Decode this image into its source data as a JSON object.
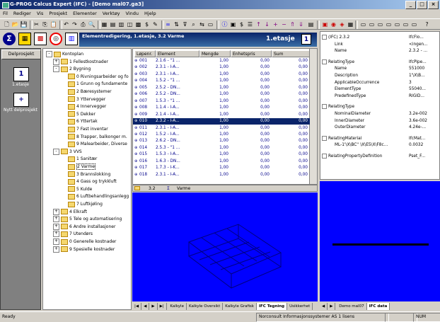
{
  "window": {
    "title": "G-PROG Calcus Expert (IFC) - [Demo mal07.ga3]"
  },
  "menu": [
    "Fil",
    "Rediger",
    "Vis",
    "Prosjekt",
    "Elementer",
    "Verktøy",
    "Vindu",
    "Hjelp"
  ],
  "header": {
    "caption": "Elementredigering,  1.etasje,  3.2 Varme",
    "title": "1.etasje",
    "badge": "1"
  },
  "sidebar": {
    "tab": "Delprosjekt",
    "items": [
      {
        "label": "1.etasje",
        "icon": "1"
      },
      {
        "label": "Nytt delprosjekt",
        "icon": "+"
      }
    ]
  },
  "tree": [
    {
      "label": "Kontoplan",
      "level": 0,
      "exp": "-"
    },
    {
      "label": "1 Fellestkostnader",
      "level": 1,
      "exp": "+"
    },
    {
      "label": "2 Bygning",
      "level": 1,
      "exp": "-"
    },
    {
      "label": "0 Rivningsarbeider og fo",
      "level": 2
    },
    {
      "label": "1 Grunn og fundamente",
      "level": 2
    },
    {
      "label": "2 Bæresystemer",
      "level": 2
    },
    {
      "label": "3 Yttervegger",
      "level": 2
    },
    {
      "label": "4 Innervegger",
      "level": 2
    },
    {
      "label": "5 Dekker",
      "level": 2
    },
    {
      "label": "6 Yttertak",
      "level": 2
    },
    {
      "label": "7 Fast inventar",
      "level": 2
    },
    {
      "label": "8 Trapper, balkonger m.",
      "level": 2
    },
    {
      "label": "9 Malearbeider, Diverse",
      "level": 2
    },
    {
      "label": "3 VVS",
      "level": 1,
      "exp": "-"
    },
    {
      "label": "1 Sanitær",
      "level": 2
    },
    {
      "label": "2 Varme",
      "level": 2,
      "selected": true
    },
    {
      "label": "3 Brannslokking",
      "level": 2
    },
    {
      "label": "4 Gass og trykkluft",
      "level": 2
    },
    {
      "label": "5 Kulde",
      "level": 2
    },
    {
      "label": "6 Luftbehandlingsanlegg",
      "level": 2
    },
    {
      "label": "7 Luftkjøling",
      "level": 2
    },
    {
      "label": "4 Elkraft",
      "level": 1,
      "exp": "+"
    },
    {
      "label": "5 Tele og automatisering",
      "level": 1,
      "exp": "+"
    },
    {
      "label": "6 Andre installasjoner",
      "level": 1,
      "exp": "+"
    },
    {
      "label": "7 Utendørs",
      "level": 1,
      "exp": "+"
    },
    {
      "label": "0 Generelle kostnader",
      "level": 1,
      "exp": "+"
    },
    {
      "label": "9 Spesielle kostnader",
      "level": 1,
      "exp": "+"
    }
  ],
  "grid": {
    "headers": [
      "Løpenr.",
      "Element",
      "Mengde",
      "Enhetspris",
      "Sum"
    ],
    "rows": [
      [
        "001",
        "2.1.6 - \"1 ...",
        "1,00",
        "0,00",
        "0,00"
      ],
      [
        "002",
        "2.3.1 - I-A...",
        "1,00",
        "0,00",
        "0,00"
      ],
      [
        "003",
        "2.3.1 - I-A...",
        "1,00",
        "0,00",
        "0,00"
      ],
      [
        "004",
        "1.5.2 - \"1 ...",
        "1,00",
        "0,00",
        "0,00"
      ],
      [
        "005",
        "2.5.2 - DN...",
        "1,00",
        "0,00",
        "0,00"
      ],
      [
        "006",
        "2.5.2 - DN...",
        "1,00",
        "0,00",
        "0,00"
      ],
      [
        "007",
        "1.5.3 - \"1 ...",
        "1,00",
        "0,00",
        "0,00"
      ],
      [
        "008",
        "1.1.4 - I-A...",
        "1,00",
        "0,00",
        "0,00"
      ],
      [
        "009",
        "2.1.4 - I-A...",
        "1,00",
        "0,00",
        "0,00"
      ],
      [
        "010",
        "2.3.2 - I-A...",
        "1,00",
        "0,00",
        "0,00"
      ],
      [
        "011",
        "2.3.1 - I-A...",
        "1,00",
        "0,00",
        "0,00"
      ],
      [
        "012",
        "1.5.2 - I-A...",
        "1,00",
        "0,00",
        "0,00"
      ],
      [
        "013",
        "2.6.2 - DN...",
        "1,00",
        "0,00",
        "0,00"
      ],
      [
        "014",
        "2.5.3 - \"1 ...",
        "1,00",
        "0,00",
        "0,00"
      ],
      [
        "015",
        "1.5.3 - I-A...",
        "1,00",
        "0,00",
        "0,00"
      ],
      [
        "016",
        "1.6.3 - DN...",
        "1,00",
        "0,00",
        "0,00"
      ],
      [
        "017",
        "1.7.3 - I-K...",
        "1,00",
        "0,00",
        "0,00"
      ],
      [
        "018",
        "2.3.1 - I-A...",
        "1,00",
        "0,00",
        "0,00"
      ]
    ],
    "selected_index": 9,
    "footer": {
      "code": "3.2",
      "name": "Varme"
    }
  },
  "tabs": [
    "Kalkyle",
    "Kalkyle Oversikt",
    "Kalkyle Grafisk",
    "IFC Tegning",
    "Usikkerhet"
  ],
  "active_tab": 3,
  "properties": [
    {
      "type": "header",
      "key": "(IFC) 2.3.2",
      "value": "IfcFlo..."
    },
    {
      "type": "row",
      "key": "Link",
      "value": "<ingen..."
    },
    {
      "type": "row",
      "key": "Name",
      "value": "2.3.2 - ..."
    },
    {
      "type": "gap"
    },
    {
      "type": "header",
      "key": "RelatingType",
      "value": "IfcPipe..."
    },
    {
      "type": "row",
      "key": "Name",
      "value": "551000"
    },
    {
      "type": "row",
      "key": "Description",
      "value": "1'\\X\\B..."
    },
    {
      "type": "row",
      "key": "ApplicableOccurrence",
      "value": "3"
    },
    {
      "type": "row",
      "key": "ElementType",
      "value": "55040..."
    },
    {
      "type": "row",
      "key": "PredefinedType",
      "value": "RIGID..."
    },
    {
      "type": "gap"
    },
    {
      "type": "header",
      "key": "RelatingType",
      "value": ""
    },
    {
      "type": "row",
      "key": "NominalDiameter",
      "value": "3.2e-002"
    },
    {
      "type": "row",
      "key": "InnerDiameter",
      "value": "3.6e-002"
    },
    {
      "type": "row",
      "key": "OuterDiameter",
      "value": "4.24e-..."
    },
    {
      "type": "gap"
    },
    {
      "type": "header",
      "key": "RelatingMaterial",
      "value": "IfcMat..."
    },
    {
      "type": "row",
      "key": "ML-1'\\X\\BC'' \\X\\E5\\X\\F8c...",
      "value": "0.0032"
    },
    {
      "type": "gap"
    },
    {
      "type": "header",
      "key": "RelatingPropertyDefinition",
      "value": "Pset_F..."
    }
  ],
  "right_tabs": [
    "Demo mal07",
    "IFC data"
  ],
  "right_active": 1,
  "status": {
    "left": "Ready",
    "company": "Norconsult Informasjonssystemer AS",
    "license": "1 lisens",
    "num": "NUM"
  },
  "colors": {
    "view_bg": "#0000ff",
    "selection": "#0a246a",
    "title_gradient_start": "#0a246a"
  }
}
